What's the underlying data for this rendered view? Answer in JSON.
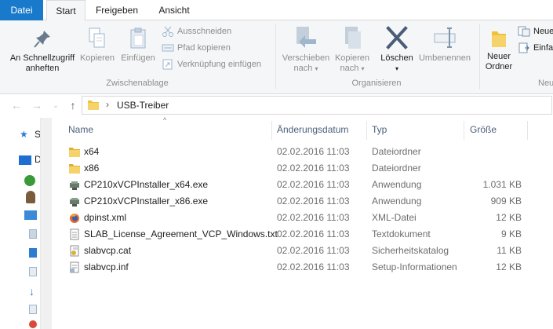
{
  "tabs": {
    "file": "Datei",
    "start": "Start",
    "share": "Freigeben",
    "view": "Ansicht"
  },
  "ribbon": {
    "clipboard": {
      "pin_label_1": "An Schnellzugriff",
      "pin_label_2": "anheften",
      "copy": "Kopieren",
      "paste": "Einfügen",
      "cut": "Ausschneiden",
      "copy_path": "Pfad kopieren",
      "paste_shortcut": "Verknüpfung einfügen",
      "group_label": "Zwischenablage"
    },
    "organize": {
      "move_1": "Verschieben",
      "move_2": "nach",
      "copyto_1": "Kopieren",
      "copyto_2": "nach",
      "delete": "Löschen",
      "rename": "Umbenennen",
      "group_label": "Organisieren"
    },
    "new": {
      "new_folder_1": "Neuer",
      "new_folder_2": "Ordner",
      "new_item": "Neue",
      "easy_access": "Einfa",
      "group_label": "Neu"
    }
  },
  "address": {
    "crumb": "USB-Treiber"
  },
  "columns": {
    "name": "Name",
    "date": "Änderungsdatum",
    "type": "Typ",
    "size": "Größe"
  },
  "files": [
    {
      "name": "x64",
      "date": "02.02.2016 11:03",
      "type": "Dateiordner",
      "size": "",
      "icon": "folder-icon"
    },
    {
      "name": "x86",
      "date": "02.02.2016 11:03",
      "type": "Dateiordner",
      "size": "",
      "icon": "folder-icon"
    },
    {
      "name": "CP210xVCPInstaller_x64.exe",
      "date": "02.02.2016 11:03",
      "type": "Anwendung",
      "size": "1.031 KB",
      "icon": "installer-icon"
    },
    {
      "name": "CP210xVCPInstaller_x86.exe",
      "date": "02.02.2016 11:03",
      "type": "Anwendung",
      "size": "909 KB",
      "icon": "installer-icon"
    },
    {
      "name": "dpinst.xml",
      "date": "02.02.2016 11:03",
      "type": "XML-Datei",
      "size": "12 KB",
      "icon": "firefox-icon"
    },
    {
      "name": "SLAB_License_Agreement_VCP_Windows.txt",
      "date": "02.02.2016 11:03",
      "type": "Textdokument",
      "size": "9 KB",
      "icon": "text-file-icon"
    },
    {
      "name": "slabvcp.cat",
      "date": "02.02.2016 11:03",
      "type": "Sicherheitskatalog",
      "size": "11 KB",
      "icon": "catalog-icon"
    },
    {
      "name": "slabvcp.inf",
      "date": "02.02.2016 11:03",
      "type": "Setup-Informationen",
      "size": "12 KB",
      "icon": "inf-file-icon"
    }
  ],
  "navpane": {
    "quick_access_initial": "S",
    "desktop_initial": "D"
  },
  "colors": {
    "accent": "#1979ca",
    "folder": "#f0c23b",
    "header_text": "#4c607a"
  }
}
